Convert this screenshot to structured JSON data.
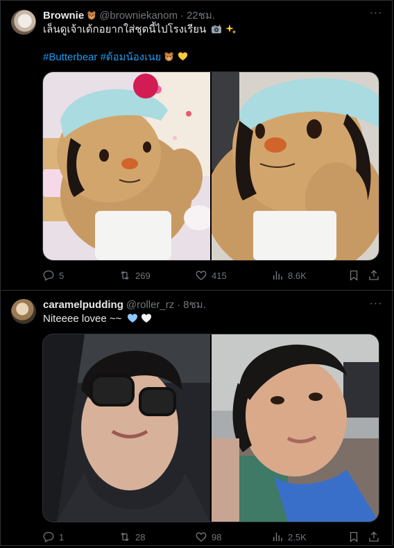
{
  "tweets": [
    {
      "author": {
        "name": "Brownie",
        "handle": "@browniekanom",
        "time": "22ชม."
      },
      "text_line1": "เล็นดูเจ้าเด้กอยากใส่ชุดนี้ไปโรงเรียน",
      "hashtag1": "#Butterbear",
      "hashtag2": "#ด้อมน้องเนย",
      "stats": {
        "replies": "5",
        "reposts": "269",
        "likes": "415",
        "views": "8.6K"
      }
    },
    {
      "author": {
        "name": "caramelpudding",
        "handle": "@roller_rz",
        "time": "8ชม."
      },
      "text_line1": "Niteeee lovee ~~",
      "stats": {
        "replies": "1",
        "reposts": "28",
        "likes": "98",
        "views": "2.5K"
      }
    }
  ],
  "colors": {
    "background": "#000000",
    "text": "#e7e9ea",
    "muted": "#71767b",
    "link": "#1d9bf0",
    "border": "#2f3336"
  },
  "icons": [
    "reply-icon",
    "repost-icon",
    "like-icon",
    "views-icon",
    "bookmark-icon",
    "share-icon",
    "more-icon"
  ]
}
